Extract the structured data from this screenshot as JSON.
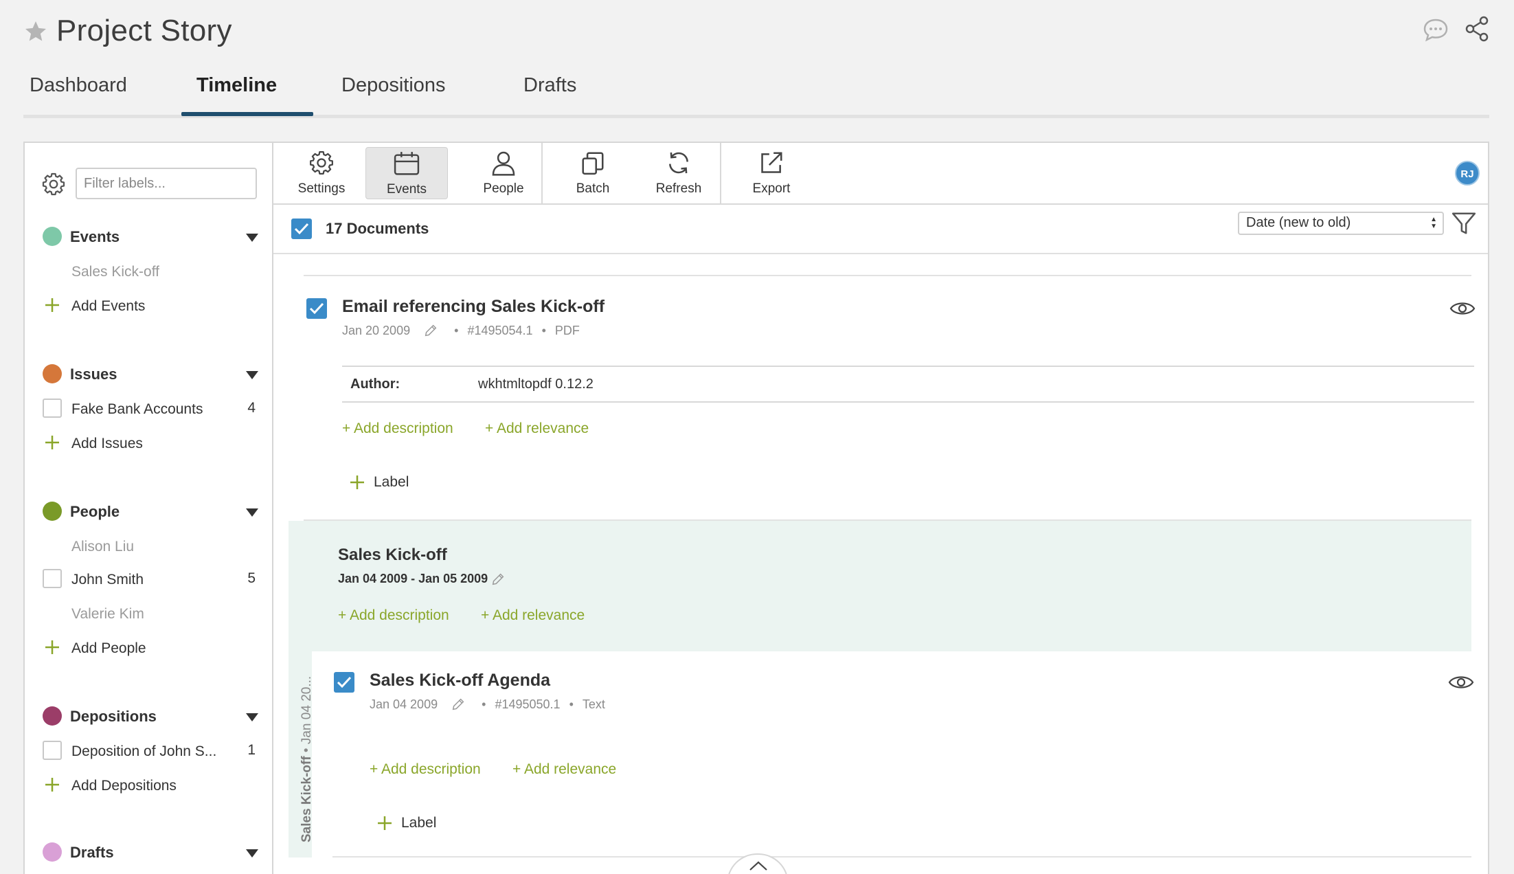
{
  "header": {
    "title": "Project Story",
    "icons": {
      "star": "star-icon",
      "chat": "chat-icon",
      "share": "share-icon"
    }
  },
  "tabs": [
    {
      "label": "Dashboard",
      "active": false
    },
    {
      "label": "Timeline",
      "active": true
    },
    {
      "label": "Depositions",
      "active": false
    },
    {
      "label": "Drafts",
      "active": false
    }
  ],
  "sidebar": {
    "filter_placeholder": "Filter labels...",
    "categories": {
      "events": {
        "name": "Events",
        "color": "#7ec8a8",
        "items": [
          {
            "label": "Sales Kick-off",
            "count": ""
          }
        ],
        "add_label": "Add Events"
      },
      "issues": {
        "name": "Issues",
        "color": "#d5773a",
        "items": [
          {
            "label": "Fake Bank Accounts",
            "count": "4"
          }
        ],
        "add_label": "Add Issues"
      },
      "people": {
        "name": "People",
        "color": "#7a9a28",
        "items": [
          {
            "label": "Alison Liu",
            "count": ""
          },
          {
            "label": "John Smith",
            "count": "5"
          },
          {
            "label": "Valerie Kim",
            "count": ""
          }
        ],
        "add_label": "Add People"
      },
      "depositions": {
        "name": "Depositions",
        "color": "#9b3d68",
        "items": [
          {
            "label": "Deposition of John S...",
            "count": "1"
          }
        ],
        "add_label": "Add Depositions"
      },
      "drafts": {
        "name": "Drafts",
        "color": "#d9a0d6"
      }
    }
  },
  "toolbar": {
    "buttons": [
      {
        "label": "Settings",
        "icon": "gear-icon"
      },
      {
        "label": "Events",
        "icon": "calendar-icon",
        "active": true
      },
      {
        "label": "People",
        "icon": "person-icon"
      },
      {
        "label": "Batch",
        "icon": "batch-icon"
      },
      {
        "label": "Refresh",
        "icon": "refresh-icon"
      },
      {
        "label": "Export",
        "icon": "export-icon"
      }
    ],
    "avatar_initials": "RJ"
  },
  "docs_bar": {
    "count_label": "17 Documents",
    "sort_value": "Date (new to old)"
  },
  "documents": [
    {
      "title": "Email referencing Sales Kick-off",
      "date": "Jan 20 2009",
      "doc_id": "#1495054.1",
      "type": "PDF",
      "author_label": "Author:",
      "author_value": "wkhtmltopdf 0.12.2",
      "add_description": "+ Add description",
      "add_relevance": "+ Add relevance",
      "label_btn": "Label"
    },
    {
      "title": "Sales Kick-off Agenda",
      "date": "Jan 04 2009",
      "doc_id": "#1495050.1",
      "type": "Text",
      "add_description": "+ Add description",
      "add_relevance": "+ Add relevance",
      "label_btn": "Label"
    }
  ],
  "event": {
    "title": "Sales Kick-off",
    "dates": "Jan 04 2009 - Jan 05 2009",
    "add_description": "+ Add description",
    "add_relevance": "+ Add relevance",
    "vertical_name": "Sales Kick-off",
    "vertical_date": "• Jan 04 20..."
  }
}
